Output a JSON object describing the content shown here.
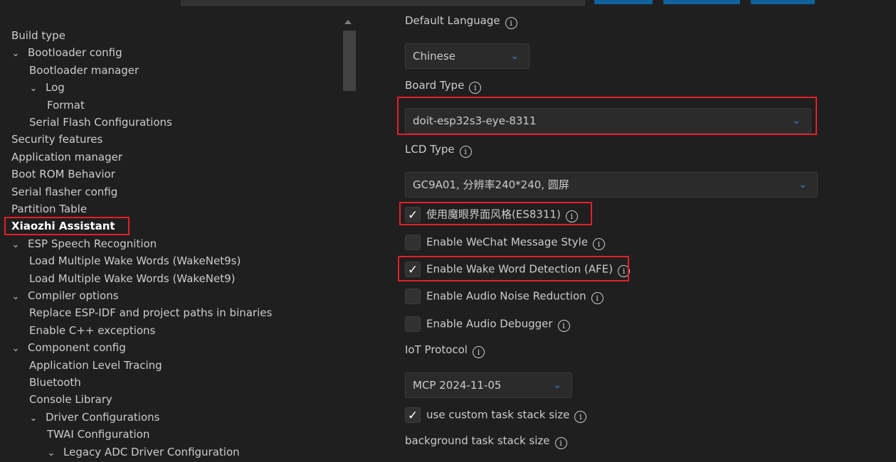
{
  "tree": [
    {
      "label": "Build type",
      "indent": 0,
      "chevron": false
    },
    {
      "label": "Bootloader config",
      "indent": 0,
      "chevron": true
    },
    {
      "label": "Bootloader manager",
      "indent": 1,
      "chevron": false
    },
    {
      "label": "Log",
      "indent": 1,
      "chevron": true
    },
    {
      "label": "Format",
      "indent": 2,
      "chevron": false
    },
    {
      "label": "Serial Flash Configurations",
      "indent": 1,
      "chevron": false
    },
    {
      "label": "Security features",
      "indent": 0,
      "chevron": false
    },
    {
      "label": "Application manager",
      "indent": 0,
      "chevron": false
    },
    {
      "label": "Boot ROM Behavior",
      "indent": 0,
      "chevron": false
    },
    {
      "label": "Serial flasher config",
      "indent": 0,
      "chevron": false
    },
    {
      "label": "Partition Table",
      "indent": 0,
      "chevron": false
    },
    {
      "label": "Xiaozhi Assistant",
      "indent": 0,
      "chevron": false,
      "bold": true
    },
    {
      "label": "ESP Speech Recognition",
      "indent": 0,
      "chevron": true
    },
    {
      "label": "Load Multiple Wake Words (WakeNet9s)",
      "indent": 1,
      "chevron": false
    },
    {
      "label": "Load Multiple Wake Words (WakeNet9)",
      "indent": 1,
      "chevron": false
    },
    {
      "label": "Compiler options",
      "indent": 0,
      "chevron": true
    },
    {
      "label": "Replace ESP-IDF and project paths in binaries",
      "indent": 1,
      "chevron": false
    },
    {
      "label": "Enable C++ exceptions",
      "indent": 1,
      "chevron": false
    },
    {
      "label": "Component config",
      "indent": 0,
      "chevron": true
    },
    {
      "label": "Application Level Tracing",
      "indent": 1,
      "chevron": false
    },
    {
      "label": "Bluetooth",
      "indent": 1,
      "chevron": false
    },
    {
      "label": "Console Library",
      "indent": 1,
      "chevron": false
    },
    {
      "label": "Driver Configurations",
      "indent": 1,
      "chevron": true
    },
    {
      "label": "TWAI Configuration",
      "indent": 2,
      "chevron": false
    },
    {
      "label": "Legacy ADC Driver Configuration",
      "indent": 2,
      "chevron": true
    }
  ],
  "icons": {
    "chevron": "chevron-down-icon",
    "info": "info-icon",
    "check": "checkmark-icon"
  },
  "form": {
    "default_language": {
      "label": "Default Language",
      "value": "Chinese"
    },
    "board_type": {
      "label": "Board Type",
      "value": "doit-esp32s3-eye-8311"
    },
    "lcd_type": {
      "label": "LCD Type",
      "value": "GC9A01, 分辨率240*240, 圆屏"
    },
    "checks": [
      {
        "label": "使用魔眼界面风格(ES8311)",
        "checked": true
      },
      {
        "label": "Enable WeChat Message Style",
        "checked": false
      },
      {
        "label": "Enable Wake Word Detection (AFE)",
        "checked": true
      },
      {
        "label": "Enable Audio Noise Reduction",
        "checked": false
      },
      {
        "label": "Enable Audio Debugger",
        "checked": false
      }
    ],
    "iot_protocol": {
      "label": "IoT Protocol",
      "value": "MCP 2024-11-05"
    },
    "custom_stack": {
      "label": "use custom task stack size",
      "checked": true
    },
    "bg_stack": {
      "label": "background task stack size"
    }
  },
  "accent": "#3c7fd6",
  "highlight": "#e3202a"
}
